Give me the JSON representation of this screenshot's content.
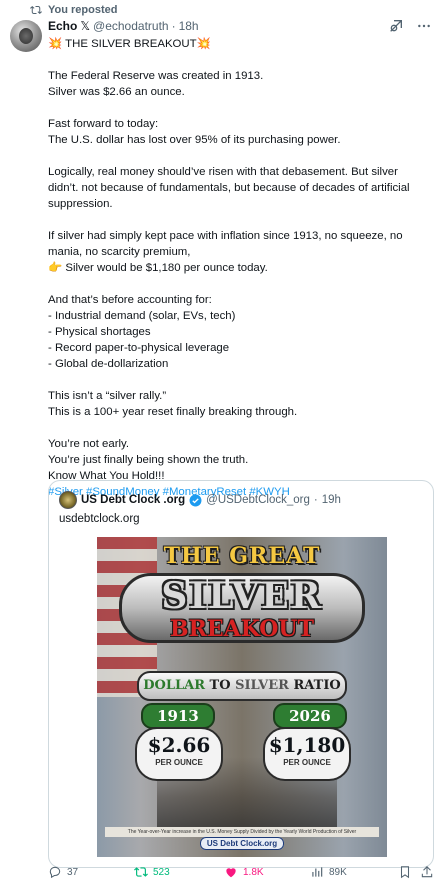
{
  "repost": {
    "label": "You reposted"
  },
  "author": {
    "name": "Echo",
    "badge": "𝕏",
    "handle": "@echodatruth",
    "time": "18h"
  },
  "post_text": "💥 THE SILVER BREAKOUT💥\n\nThe Federal Reserve was created in 1913.\nSilver was $2.66 an ounce.\n\nFast forward to today:\nThe U.S. dollar has lost over 95% of its purchasing power.\n\nLogically, real money should’ve risen with that debasement. But silver didn’t. not because of fundamentals, but because of decades of artificial suppression.\n\nIf silver had simply kept pace with inflation since 1913, no squeeze, no mania, no scarcity premium,\n👉 Silver would be $1,180 per ounce today.\n\nAnd that’s before accounting for:\n- Industrial demand (solar, EVs, tech)\n- Physical shortages\n- Record paper-to-physical leverage\n- Global de-dollarization\n\nThis isn’t a “silver rally.”\nThis is a 100+ year reset finally breaking through.\n\nYou’re not early.\nYou’re just finally being shown the truth.\nKnow What You Hold!!!",
  "hashtags": "#Silver #SoundMoney #MonetaryReset #KWYH",
  "quote": {
    "name": "US Debt Clock .org",
    "handle": "@USDebtClock_org",
    "time": "19h",
    "link_text": "usdebtclock.org",
    "poster": {
      "line1": "THE GREAT",
      "line2": "SILVER",
      "line3": "BREAKOUT",
      "ratio_a": "DOLLAR",
      "ratio_to": " TO ",
      "ratio_b": "SILVER",
      "ratio_c": " RATIO",
      "year1": "1913",
      "year2": "2026",
      "price1": "$2.66",
      "price2": "$1,180",
      "per": "PER OUNCE",
      "caption": "The Year-over-Year increase in the U.S. Money Supply Divided by the Yearly World Production of Silver",
      "logo": "US Debt Clock.org"
    }
  },
  "actions": {
    "replies": "37",
    "reposts": "523",
    "likes": "1.8K",
    "views": "89K"
  }
}
